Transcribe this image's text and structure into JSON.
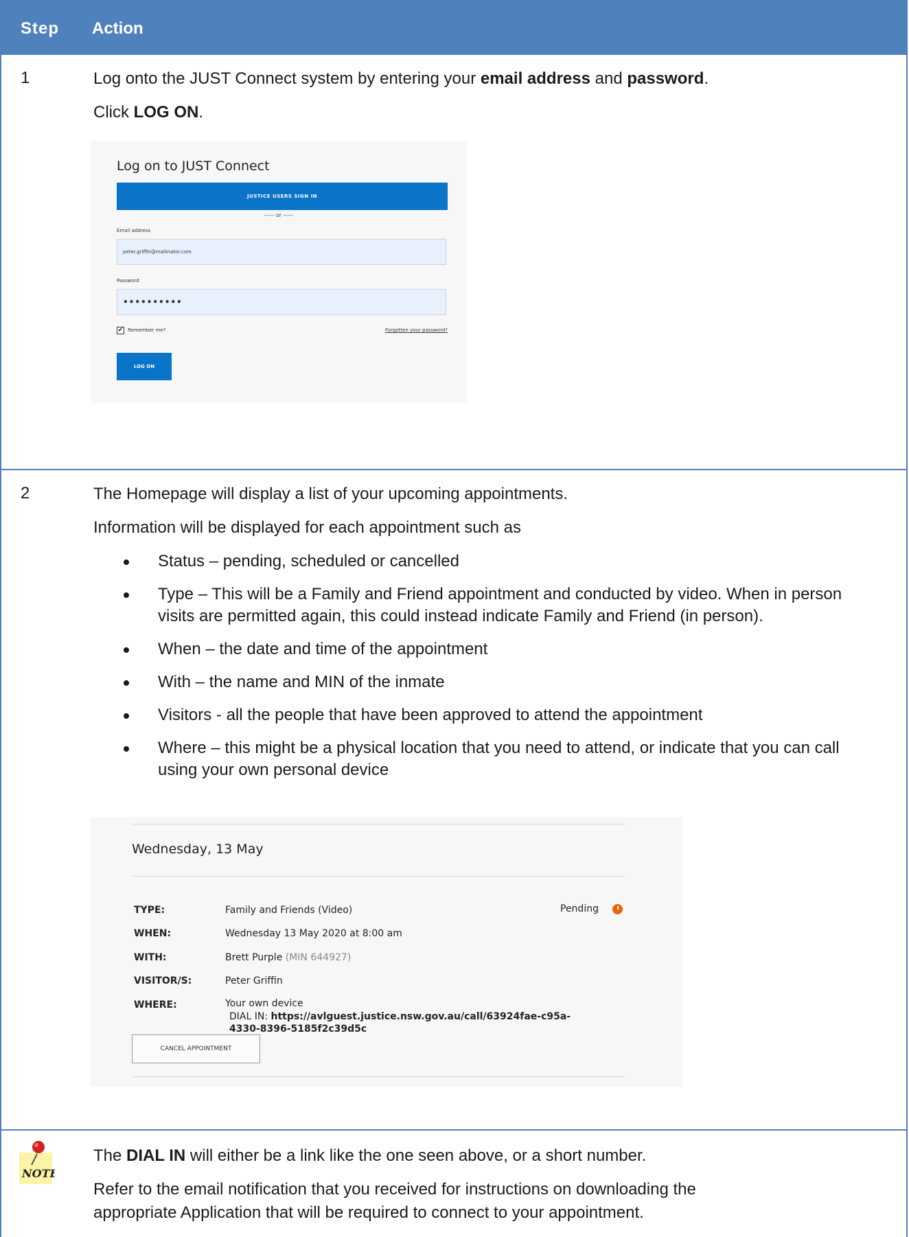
{
  "header": {
    "col_step": "Step",
    "col_action": "Action"
  },
  "steps": [
    {
      "number": "1",
      "line1_pre": "Log onto the JUST Connect system by entering your ",
      "line1_b1": "email address",
      "line1_mid": " and ",
      "line1_b2": "password",
      "line1_end": ".",
      "line2_pre": "Click ",
      "line2_b": "LOG ON",
      "line2_end": ".",
      "login": {
        "title": "Log on to JUST Connect",
        "sso_button": "JUSTICE USERS SIGN IN",
        "or_text": "----- or -----",
        "email_label": "Email address",
        "email_value": "peter.griffin@mailinator.com",
        "password_label": "Password",
        "password_value": "••••••••••",
        "remember_checked": true,
        "remember_label": "Remember me?",
        "forgot_link": "Forgotten your password?",
        "logon_button": "LOG ON"
      }
    },
    {
      "number": "2",
      "line1": "The Homepage will display a list of your upcoming appointments.",
      "line2": "Information will be displayed for each appointment such as",
      "bullets": [
        "Status – pending, scheduled or cancelled",
        "Type – This will be a Family and Friend appointment and conducted by video. When in person visits are permitted again, this could instead indicate Family and Friend (in person).",
        "When – the date and time of the appointment",
        "With – the name and MIN of the inmate",
        "Visitors - all the people that have been approved to attend the appointment",
        "Where – this might be a physical location that you need to attend, or indicate that you can call using your own personal device"
      ],
      "appointment": {
        "date_heading": "Wednesday, 13 May",
        "type_label": "TYPE:",
        "type_value": "Family and Friends (Video)",
        "status": "Pending",
        "when_label": "WHEN:",
        "when_value": "Wednesday 13 May 2020 at 8:00 am",
        "with_label": "WITH:",
        "with_name": "Brett Purple",
        "with_min": " (MIN 644927)",
        "visitors_label": "VISITOR/S:",
        "visitors_value": "Peter Griffin",
        "where_label": "WHERE:",
        "where_value": "Your own device",
        "dial_in_label": "DIAL IN: ",
        "dial_in_link_1": "https://avlguest.justice.nsw.gov.au/call/63924fae-c95a-",
        "dial_in_link_2": "4330-8396-5185f2c39d5c",
        "cancel_button": "CANCEL APPOINTMENT"
      }
    }
  ],
  "note": {
    "icon_label": "NOTE",
    "line1_pre": "The ",
    "line1_b": "DIAL IN",
    "line1_end": " will either be a link like the one seen above, or a short number.",
    "line2": "Refer to the email notification that you received for instructions on downloading the",
    "line3": "appropriate Application that will be required to connect to your appointment."
  }
}
